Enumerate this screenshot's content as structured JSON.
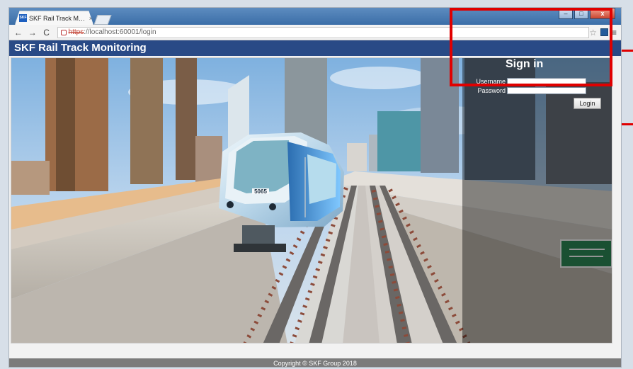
{
  "browser": {
    "tab_title": "SKF Rail Track Monitoring",
    "tab_close": "×",
    "url_scheme": "https",
    "url_rest": "://localhost:60001/login",
    "back_icon": "←",
    "forward_icon": "→",
    "reload_icon": "C",
    "window_controls": [
      "–",
      "□",
      "x"
    ]
  },
  "app": {
    "title": "SKF Rail Track Monitoring",
    "footer": "Copyright © SKF Group 2018"
  },
  "signin": {
    "title": "Sign in",
    "username_label": "Username",
    "password_label": "Password",
    "username_value": "",
    "password_value": "",
    "login_label": "Login"
  },
  "hero": {
    "train_number": "5065"
  },
  "colors": {
    "header_bg": "#294a86",
    "annotation": "#e00000",
    "footer_bg": "#7b7b7b"
  }
}
